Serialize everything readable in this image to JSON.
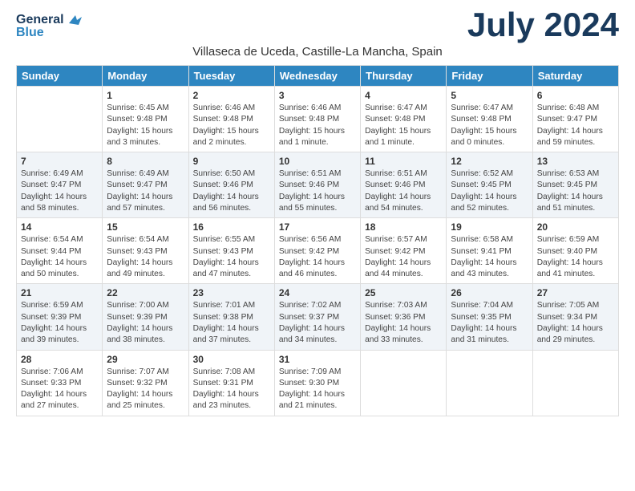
{
  "header": {
    "logo_line1": "General",
    "logo_line2": "Blue",
    "month_year": "July 2024",
    "location": "Villaseca de Uceda, Castille-La Mancha, Spain"
  },
  "weekdays": [
    "Sunday",
    "Monday",
    "Tuesday",
    "Wednesday",
    "Thursday",
    "Friday",
    "Saturday"
  ],
  "weeks": [
    [
      {
        "day": "",
        "info": ""
      },
      {
        "day": "1",
        "info": "Sunrise: 6:45 AM\nSunset: 9:48 PM\nDaylight: 15 hours\nand 3 minutes."
      },
      {
        "day": "2",
        "info": "Sunrise: 6:46 AM\nSunset: 9:48 PM\nDaylight: 15 hours\nand 2 minutes."
      },
      {
        "day": "3",
        "info": "Sunrise: 6:46 AM\nSunset: 9:48 PM\nDaylight: 15 hours\nand 1 minute."
      },
      {
        "day": "4",
        "info": "Sunrise: 6:47 AM\nSunset: 9:48 PM\nDaylight: 15 hours\nand 1 minute."
      },
      {
        "day": "5",
        "info": "Sunrise: 6:47 AM\nSunset: 9:48 PM\nDaylight: 15 hours\nand 0 minutes."
      },
      {
        "day": "6",
        "info": "Sunrise: 6:48 AM\nSunset: 9:47 PM\nDaylight: 14 hours\nand 59 minutes."
      }
    ],
    [
      {
        "day": "7",
        "info": "Sunrise: 6:49 AM\nSunset: 9:47 PM\nDaylight: 14 hours\nand 58 minutes."
      },
      {
        "day": "8",
        "info": "Sunrise: 6:49 AM\nSunset: 9:47 PM\nDaylight: 14 hours\nand 57 minutes."
      },
      {
        "day": "9",
        "info": "Sunrise: 6:50 AM\nSunset: 9:46 PM\nDaylight: 14 hours\nand 56 minutes."
      },
      {
        "day": "10",
        "info": "Sunrise: 6:51 AM\nSunset: 9:46 PM\nDaylight: 14 hours\nand 55 minutes."
      },
      {
        "day": "11",
        "info": "Sunrise: 6:51 AM\nSunset: 9:46 PM\nDaylight: 14 hours\nand 54 minutes."
      },
      {
        "day": "12",
        "info": "Sunrise: 6:52 AM\nSunset: 9:45 PM\nDaylight: 14 hours\nand 52 minutes."
      },
      {
        "day": "13",
        "info": "Sunrise: 6:53 AM\nSunset: 9:45 PM\nDaylight: 14 hours\nand 51 minutes."
      }
    ],
    [
      {
        "day": "14",
        "info": "Sunrise: 6:54 AM\nSunset: 9:44 PM\nDaylight: 14 hours\nand 50 minutes."
      },
      {
        "day": "15",
        "info": "Sunrise: 6:54 AM\nSunset: 9:43 PM\nDaylight: 14 hours\nand 49 minutes."
      },
      {
        "day": "16",
        "info": "Sunrise: 6:55 AM\nSunset: 9:43 PM\nDaylight: 14 hours\nand 47 minutes."
      },
      {
        "day": "17",
        "info": "Sunrise: 6:56 AM\nSunset: 9:42 PM\nDaylight: 14 hours\nand 46 minutes."
      },
      {
        "day": "18",
        "info": "Sunrise: 6:57 AM\nSunset: 9:42 PM\nDaylight: 14 hours\nand 44 minutes."
      },
      {
        "day": "19",
        "info": "Sunrise: 6:58 AM\nSunset: 9:41 PM\nDaylight: 14 hours\nand 43 minutes."
      },
      {
        "day": "20",
        "info": "Sunrise: 6:59 AM\nSunset: 9:40 PM\nDaylight: 14 hours\nand 41 minutes."
      }
    ],
    [
      {
        "day": "21",
        "info": "Sunrise: 6:59 AM\nSunset: 9:39 PM\nDaylight: 14 hours\nand 39 minutes."
      },
      {
        "day": "22",
        "info": "Sunrise: 7:00 AM\nSunset: 9:39 PM\nDaylight: 14 hours\nand 38 minutes."
      },
      {
        "day": "23",
        "info": "Sunrise: 7:01 AM\nSunset: 9:38 PM\nDaylight: 14 hours\nand 37 minutes."
      },
      {
        "day": "24",
        "info": "Sunrise: 7:02 AM\nSunset: 9:37 PM\nDaylight: 14 hours\nand 34 minutes."
      },
      {
        "day": "25",
        "info": "Sunrise: 7:03 AM\nSunset: 9:36 PM\nDaylight: 14 hours\nand 33 minutes."
      },
      {
        "day": "26",
        "info": "Sunrise: 7:04 AM\nSunset: 9:35 PM\nDaylight: 14 hours\nand 31 minutes."
      },
      {
        "day": "27",
        "info": "Sunrise: 7:05 AM\nSunset: 9:34 PM\nDaylight: 14 hours\nand 29 minutes."
      }
    ],
    [
      {
        "day": "28",
        "info": "Sunrise: 7:06 AM\nSunset: 9:33 PM\nDaylight: 14 hours\nand 27 minutes."
      },
      {
        "day": "29",
        "info": "Sunrise: 7:07 AM\nSunset: 9:32 PM\nDaylight: 14 hours\nand 25 minutes."
      },
      {
        "day": "30",
        "info": "Sunrise: 7:08 AM\nSunset: 9:31 PM\nDaylight: 14 hours\nand 23 minutes."
      },
      {
        "day": "31",
        "info": "Sunrise: 7:09 AM\nSunset: 9:30 PM\nDaylight: 14 hours\nand 21 minutes."
      },
      {
        "day": "",
        "info": ""
      },
      {
        "day": "",
        "info": ""
      },
      {
        "day": "",
        "info": ""
      }
    ]
  ]
}
